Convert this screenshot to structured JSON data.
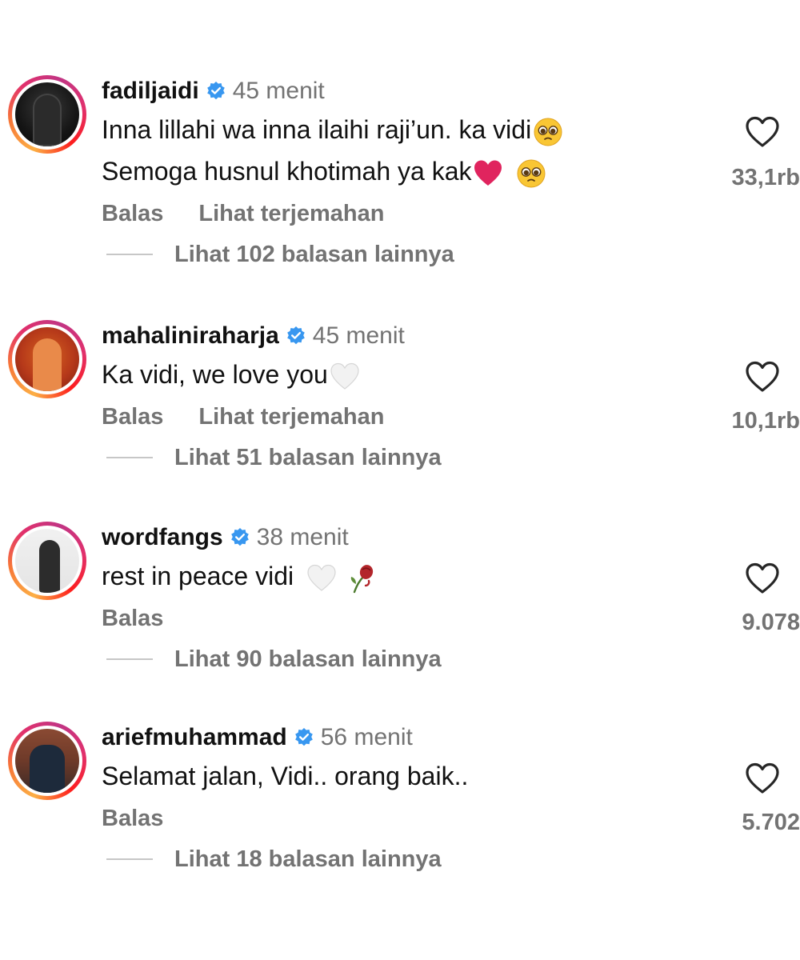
{
  "comments": [
    {
      "username": "fadiljaidi",
      "time": "45 menit",
      "line1": "Inna lillahi wa inna ilaihi raji’un. ka vidi",
      "line2": "Semoga husnul khotimah ya kak",
      "reply_label": "Balas",
      "translate_label": "Lihat terjemahan",
      "more_replies": "Lihat 102 balasan lainnya",
      "likes": "33,1rb",
      "emojis": [
        "pleading-face",
        "red-heart",
        "pleading-face"
      ]
    },
    {
      "username": "mahaliniraharja",
      "time": "45 menit",
      "line1": "Ka vidi, we love you",
      "reply_label": "Balas",
      "translate_label": "Lihat terjemahan",
      "more_replies": "Lihat 51 balasan lainnya",
      "likes": "10,1rb",
      "emojis": [
        "white-heart"
      ]
    },
    {
      "username": "wordfangs",
      "time": "38 menit",
      "line1": "rest in peace vidi",
      "reply_label": "Balas",
      "more_replies": "Lihat 90 balasan lainnya",
      "likes": "9.078",
      "emojis": [
        "white-heart",
        "wilted-rose"
      ]
    },
    {
      "username": "ariefmuhammad",
      "time": "56 menit",
      "line1": "Selamat jalan, Vidi.. orang baik..",
      "reply_label": "Balas",
      "more_replies": "Lihat 18 balasan lainnya",
      "likes": "5.702",
      "emojis": []
    }
  ],
  "colors": {
    "verified_badge": "#3897f0",
    "secondary_text": "#737373",
    "primary_text": "#111111",
    "heart_emoji": "#e0245e"
  },
  "icons": {
    "like": "heart-outline-icon",
    "verified": "verified-badge-icon"
  }
}
